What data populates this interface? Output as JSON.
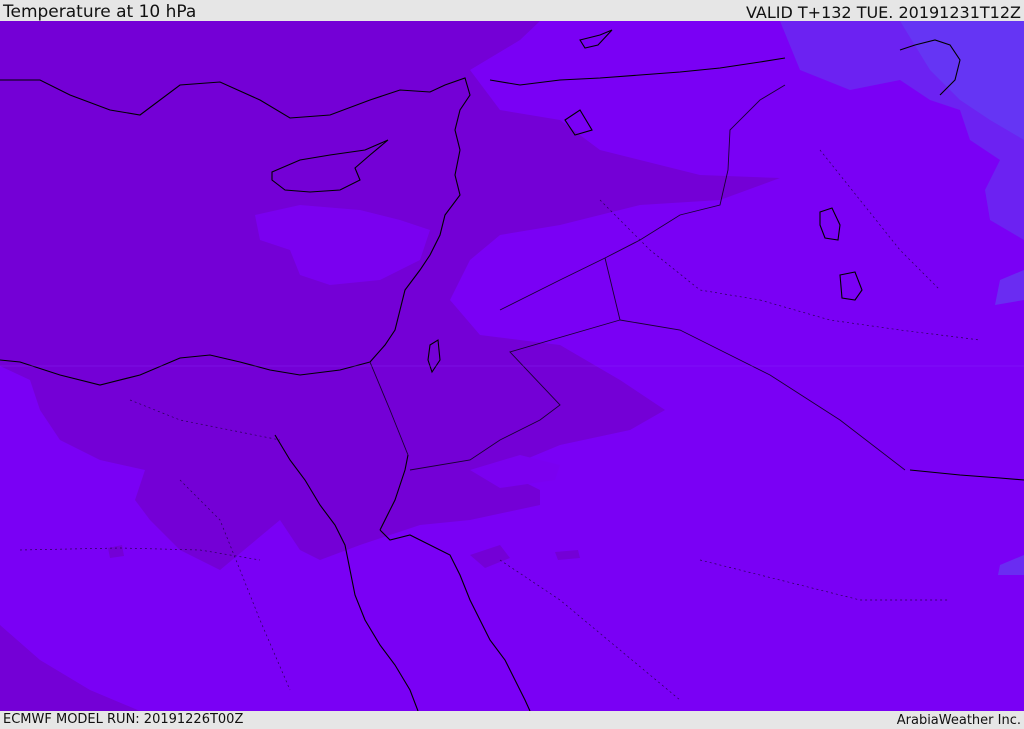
{
  "header": {
    "title": "Temperature at 10 hPa",
    "valid": "VALID T+132 TUE. 20191231T12Z"
  },
  "footer": {
    "model_run": "ECMWF MODEL RUN: 20191226T00Z",
    "credit": "ArabiaWeather Inc."
  },
  "map": {
    "colors": {
      "base_violet": "#7a00f5",
      "dark_purple": "#7500d8",
      "mid_purple": "#7a00e8",
      "blue_violet": "#6f1cf0",
      "light_blue_violet": "#6a30f2",
      "coastline": "#000000",
      "borders": "#1a0033"
    }
  }
}
